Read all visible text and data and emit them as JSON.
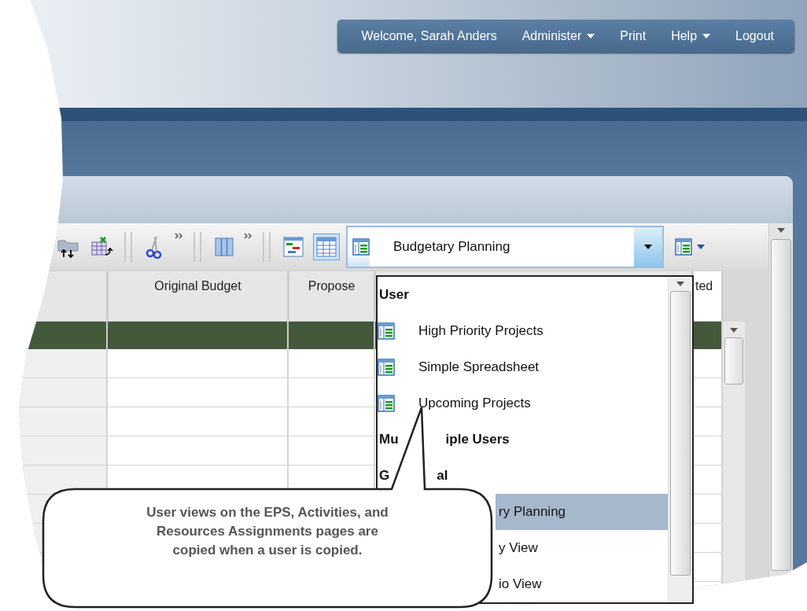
{
  "nav": [
    {
      "label": "Welcome, Sarah Anders",
      "kind": "text"
    },
    {
      "label": "Administer",
      "kind": "menu"
    },
    {
      "label": "Print",
      "kind": "link"
    },
    {
      "label": "Help",
      "kind": "menu"
    },
    {
      "label": "Logout",
      "kind": "link"
    }
  ],
  "view_buttons": [
    {
      "selected": false
    },
    {
      "selected": true
    }
  ],
  "view_selector": {
    "value": "Budgetary Planning",
    "expanded": true
  },
  "table": {
    "columns": [
      {
        "label": "Original Budget"
      },
      {
        "label": "Propose"
      },
      {
        "label": "ted"
      }
    ]
  },
  "dropdown": {
    "items": [
      {
        "kind": "header",
        "parts": [
          "User"
        ]
      },
      {
        "kind": "view",
        "label": "High Priority Projects",
        "selected": false,
        "covered": false
      },
      {
        "kind": "view",
        "label": "Simple Spreadsheet",
        "selected": false,
        "covered": false
      },
      {
        "kind": "view",
        "label": "Upcoming Projects",
        "selected": false,
        "covered": false
      },
      {
        "kind": "header",
        "parts": [
          "Mu",
          "iple Users"
        ]
      },
      {
        "kind": "header",
        "parts": [
          "G",
          "al"
        ]
      },
      {
        "kind": "view",
        "label": "ry Planning",
        "selected": true,
        "covered": true
      },
      {
        "kind": "view",
        "label": "y View",
        "selected": false,
        "covered": true
      },
      {
        "kind": "view",
        "label": "io View",
        "selected": false,
        "covered": true
      }
    ]
  },
  "callout": {
    "text": "User views on the EPS, Activities, and Resources Assignments pages are copied when a user is copied."
  }
}
